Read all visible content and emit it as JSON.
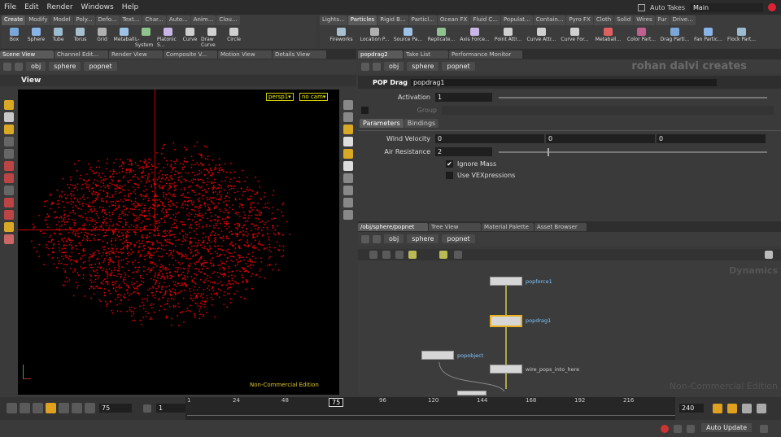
{
  "menu": [
    "File",
    "Edit",
    "Render",
    "Windows",
    "Help"
  ],
  "takes": {
    "label": "Auto Takes",
    "value": "Main"
  },
  "left_shelf_tabs": [
    "Create",
    "Modify",
    "Model",
    "Poly...",
    "Defo...",
    "Text...",
    "Char...",
    "Auto...",
    "Anim...",
    "Clou..."
  ],
  "left_tools": [
    {
      "label": "Box",
      "icon": "box-icon"
    },
    {
      "label": "Sphere",
      "icon": "sphere-icon"
    },
    {
      "label": "Tube",
      "icon": "tube-icon"
    },
    {
      "label": "Torus",
      "icon": "torus-icon"
    },
    {
      "label": "Grid",
      "icon": "grid-icon"
    },
    {
      "label": "Metaball",
      "icon": "metaball-icon"
    },
    {
      "label": "L-System",
      "icon": "lsystem-icon"
    },
    {
      "label": "Platonic S...",
      "icon": "platonic-icon"
    },
    {
      "label": "Curve",
      "icon": "curve-icon"
    },
    {
      "label": "Draw Curve",
      "icon": "draw-curve-icon"
    },
    {
      "label": "Circle",
      "icon": "circle-icon"
    }
  ],
  "right_shelf_tabs": [
    "Lights...",
    "Particles",
    "Rigid B...",
    "Particl...",
    "Ocean FX",
    "Fluid C...",
    "Populat...",
    "Contain...",
    "Pyro FX",
    "Cloth",
    "Solid",
    "Wires",
    "Fur",
    "Drive..."
  ],
  "right_tools": [
    {
      "label": "Fireworks",
      "icon": "fireworks-icon"
    },
    {
      "label": "Location P...",
      "icon": "location-icon"
    },
    {
      "label": "Source Pa...",
      "icon": "source-icon"
    },
    {
      "label": "Replicate...",
      "icon": "replicate-icon"
    },
    {
      "label": "Axis Force...",
      "icon": "axis-icon"
    },
    {
      "label": "Point Attr...",
      "icon": "point-icon"
    },
    {
      "label": "Curve Attr...",
      "icon": "curve-attr-icon"
    },
    {
      "label": "Curve For...",
      "icon": "curve-force-icon"
    },
    {
      "label": "Metaball...",
      "icon": "metaball2-icon"
    },
    {
      "label": "Color Part...",
      "icon": "color-icon"
    },
    {
      "label": "Drag Parti...",
      "icon": "drag-icon"
    },
    {
      "label": "Fan Partic...",
      "icon": "fan-icon"
    },
    {
      "label": "Flock Part...",
      "icon": "flock-icon"
    }
  ],
  "left_pane_tabs": [
    "Scene View",
    "Channel Edit...",
    "Render View",
    "Composite V...",
    "Motion View",
    "Details View"
  ],
  "path": {
    "obj": "obj",
    "sphere": "sphere",
    "popnet": "popnet"
  },
  "viewport": {
    "title": "View",
    "camera": "persp1▾",
    "nocam": "no cam▾",
    "watermark": "Non-Commercial Edition"
  },
  "parm_tabs_top": [
    "popdrag2",
    "Take List",
    "Performance Monitor"
  ],
  "brand": "rohan dalvi creates",
  "node_type": "POP Drag",
  "node_name": "popdrag1",
  "activation": {
    "label": "Activation",
    "value": "1"
  },
  "group": {
    "label": "Group"
  },
  "parm_tabs": [
    "Parameters",
    "Bindings"
  ],
  "wind": {
    "label": "Wind Velocity",
    "x": "0",
    "y": "0",
    "z": "0"
  },
  "air": {
    "label": "Air Resistance",
    "value": "2"
  },
  "ignore_mass": "Ignore Mass",
  "use_vex": "Use VEXpressions",
  "net_tabs": [
    "/obj/sphere/popnet",
    "Tree View",
    "Material Palette",
    "Asset Browser"
  ],
  "network": {
    "context": "Dynamics",
    "watermark": "Non-Commercial Edition",
    "nodes": [
      "popforce1",
      "popdrag1",
      "popobject",
      "wire_pops_into_here"
    ]
  },
  "timeline": {
    "start": "75",
    "frame": "1",
    "current": "75",
    "end": "240",
    "ticks": [
      "1",
      "24",
      "48",
      "72",
      "96",
      "120",
      "144",
      "168",
      "192",
      "216"
    ]
  },
  "status": {
    "auto_update": "Auto Update"
  },
  "colors": {
    "particles": "#e00000",
    "selected_node": "#e8b020",
    "bg": "#3a3a3a"
  }
}
